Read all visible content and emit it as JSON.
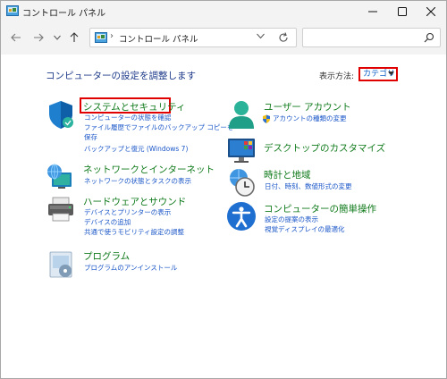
{
  "window": {
    "title": "コントロール パネル",
    "accent_color": "#0067c0"
  },
  "nav": {
    "breadcrumb_sep": "›",
    "address_text": "コントロール パネル",
    "search_placeholder": ""
  },
  "main": {
    "page_title": "コンピューターの設定を調整します",
    "view_by_label": "表示方法:",
    "view_by_value": "カテゴリ"
  },
  "categories": [
    {
      "icon": "shield-icon",
      "title": "システムとセキュリティ",
      "links": [
        "コンピューターの状態を確認",
        "ファイル履歴でファイルのバックアップ コピーを",
        "保存",
        "バックアップと復元 (Windows 7)"
      ]
    },
    {
      "icon": "network-icon",
      "title": "ネットワークとインターネット",
      "links": [
        "ネットワークの状態とタスクの表示"
      ]
    },
    {
      "icon": "printer-icon",
      "title": "ハードウェアとサウンド",
      "links": [
        "デバイスとプリンターの表示",
        "デバイスの追加",
        "共通で使うモビリティ設定の調整"
      ]
    },
    {
      "icon": "programs-icon",
      "title": "プログラム",
      "links": [
        "プログラムのアンインストール"
      ]
    },
    {
      "icon": "user-icon",
      "title": "ユーザー アカウント",
      "links": [
        "アカウントの種類の変更"
      ]
    },
    {
      "icon": "desktop-icon",
      "title": "デスクトップのカスタマイズ",
      "links": []
    },
    {
      "icon": "clock-icon",
      "title": "時計と地域",
      "links": [
        "日付、時刻、数値形式の変更"
      ]
    },
    {
      "icon": "accessibility-icon",
      "title": "コンピューターの簡単操作",
      "links": [
        "設定の提案の表示",
        "視覚ディスプレイの最適化"
      ]
    }
  ]
}
